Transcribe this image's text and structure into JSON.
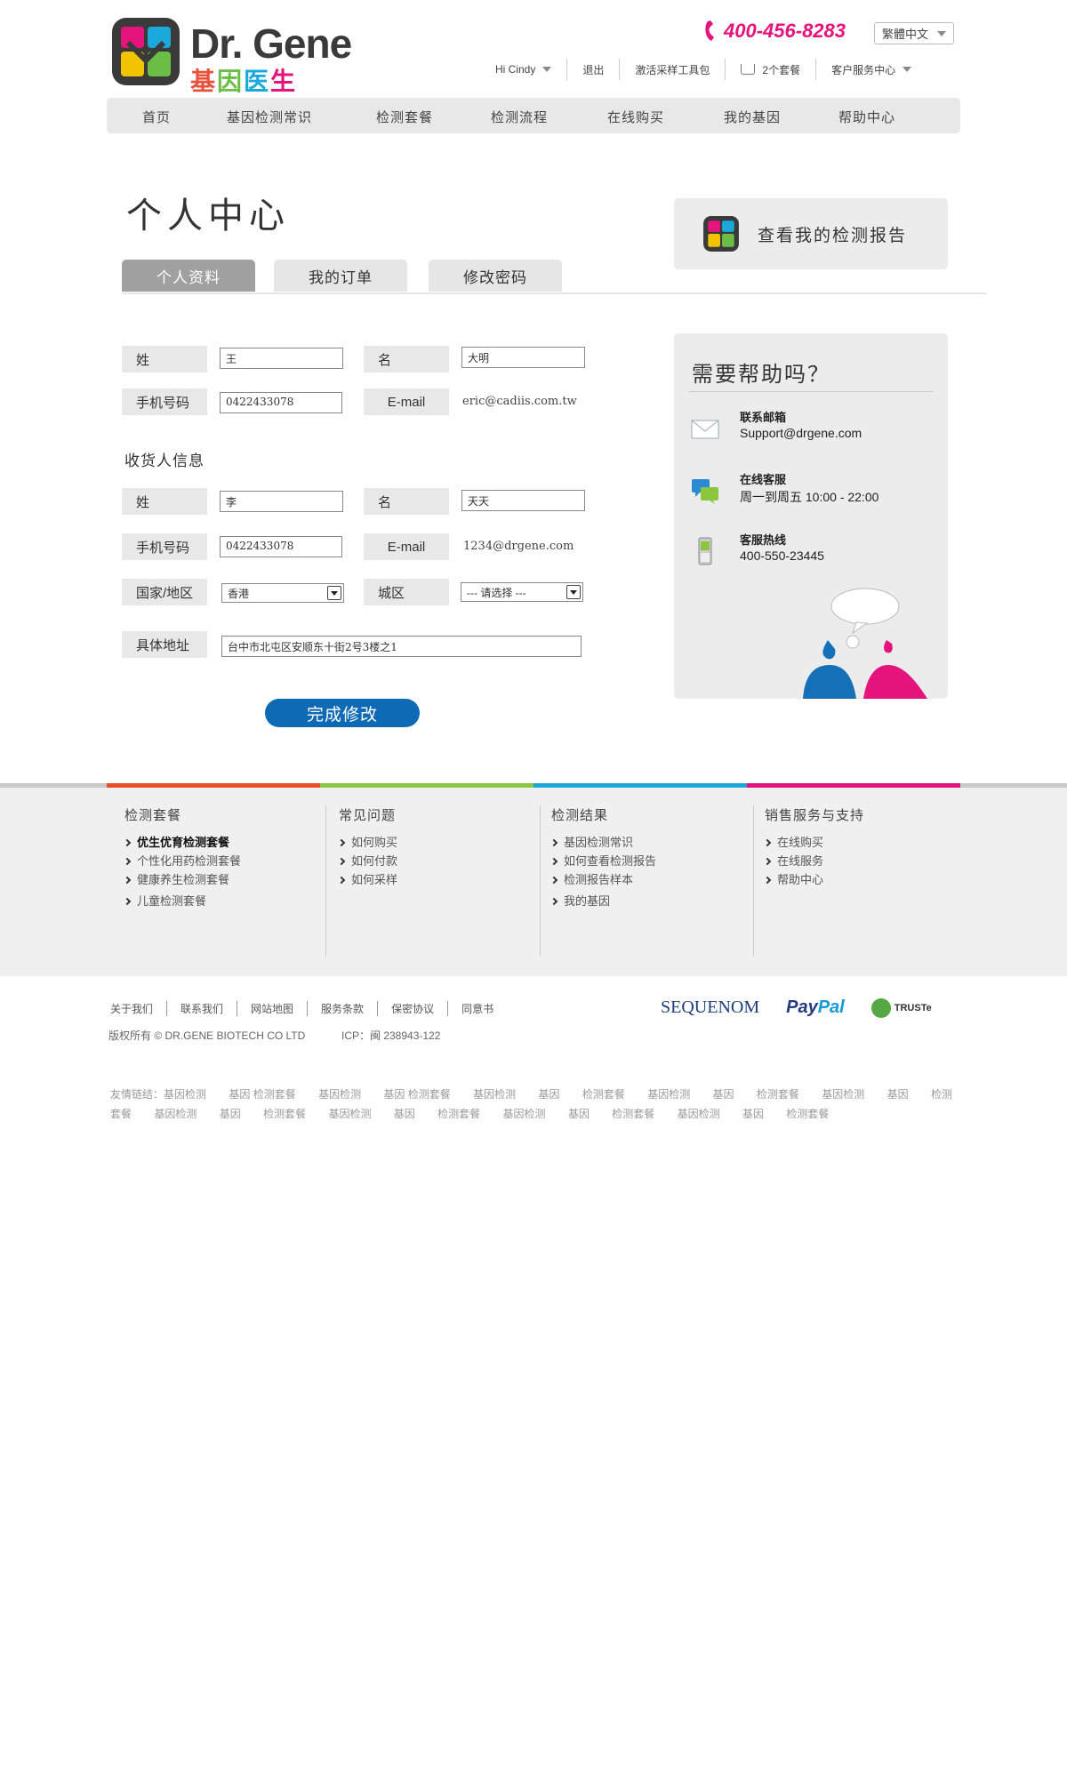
{
  "header": {
    "brand_en": "Dr. Gene",
    "brand_cn": [
      "基",
      "因",
      "医",
      "生"
    ],
    "phone": "400-456-8283",
    "language": "繁體中文",
    "user_greeting": "Hi Cindy",
    "logout": "退出",
    "activate_kit": "激活采样工具包",
    "cart": "2个套餐",
    "customer_center": "客户服务中心"
  },
  "nav": [
    "首页",
    "基因检测常识",
    "检测套餐",
    "检测流程",
    "在线购买",
    "我的基因",
    "帮助中心"
  ],
  "page": {
    "title": "个人中心",
    "report_button": "查看我的检测报告",
    "tabs": [
      "个人资料",
      "我的订单",
      "修改密码"
    ]
  },
  "profile": {
    "surname_label": "姓",
    "surname": "王",
    "name_label": "名",
    "name": "大明",
    "mobile_label": "手机号码",
    "mobile": "0422433078",
    "email_label": "E-mail",
    "email": "eric@cadiis.com.tw"
  },
  "recipient": {
    "section_title": "收货人信息",
    "surname_label": "姓",
    "surname": "李",
    "name_label": "名",
    "name": "天天",
    "mobile_label": "手机号码",
    "mobile": "0422433078",
    "email_label": "E-mail",
    "email": "1234@drgene.com",
    "country_label": "国家/地区",
    "country": "香港",
    "city_label": "城区",
    "city": "--- 请选择 ---",
    "address_label": "具体地址",
    "address": "台中市北屯区安顺东十街2号3楼之1"
  },
  "submit_label": "完成修改",
  "help": {
    "title": "需要帮助吗？",
    "email_title": "联系邮箱",
    "email_value": "Support@drgene.com",
    "chat_title": "在线客服",
    "chat_value": "周一到周五 10:00 - 22:00",
    "hotline_title": "客服热线",
    "hotline_value": "400-550-23445"
  },
  "footer": {
    "stripe_colors": [
      "#e8502a",
      "#8cc63f",
      "#1ba9dc",
      "#e4147c"
    ],
    "columns": [
      {
        "title": "检测套餐",
        "items": [
          "优生优育检测套餐",
          "个性化用药检测套餐",
          "健康养生检测套餐",
          "儿童检测套餐"
        ]
      },
      {
        "title": "常见问题",
        "items": [
          "如何购买",
          "如何付款",
          "如何采样"
        ]
      },
      {
        "title": "检测结果",
        "items": [
          "基因检测常识",
          "如何查看检测报告",
          "检测报告样本",
          "我的基因"
        ]
      },
      {
        "title": "销售服务与支持",
        "items": [
          "在线购买",
          "在线服务",
          "帮助中心"
        ]
      }
    ],
    "links": [
      "关于我们",
      "联系我们",
      "网站地图",
      "服务条款",
      "保密协议",
      "同意书"
    ],
    "copyright": "版权所有 © DR.GENE BIOTECH  CO LTD",
    "icp": "ICP：闽 238943-122",
    "partners": {
      "sequenom": "SEQUENOM",
      "paypal_a": "Pay",
      "paypal_b": "Pal",
      "truste": "TRUSTe"
    },
    "friend_prefix": "友情链结：",
    "friend_links": [
      "基因检测",
      "基因 检测套餐",
      "基因检测",
      "基因 检测套餐",
      "基因检测",
      "基因",
      "检测套餐",
      "基因检测",
      "基因",
      "检测套餐",
      "基因检测",
      "基因",
      "检测套餐",
      "基因检测",
      "基因",
      "检测套餐",
      "基因检测",
      "基因",
      "检测套餐",
      "基因检测",
      "基因",
      "检测套餐",
      "基因检测",
      "基因",
      "检测套餐"
    ]
  },
  "colors": {
    "accent_blue": "#0f6ab6",
    "brand_pink": "#e4147c"
  }
}
